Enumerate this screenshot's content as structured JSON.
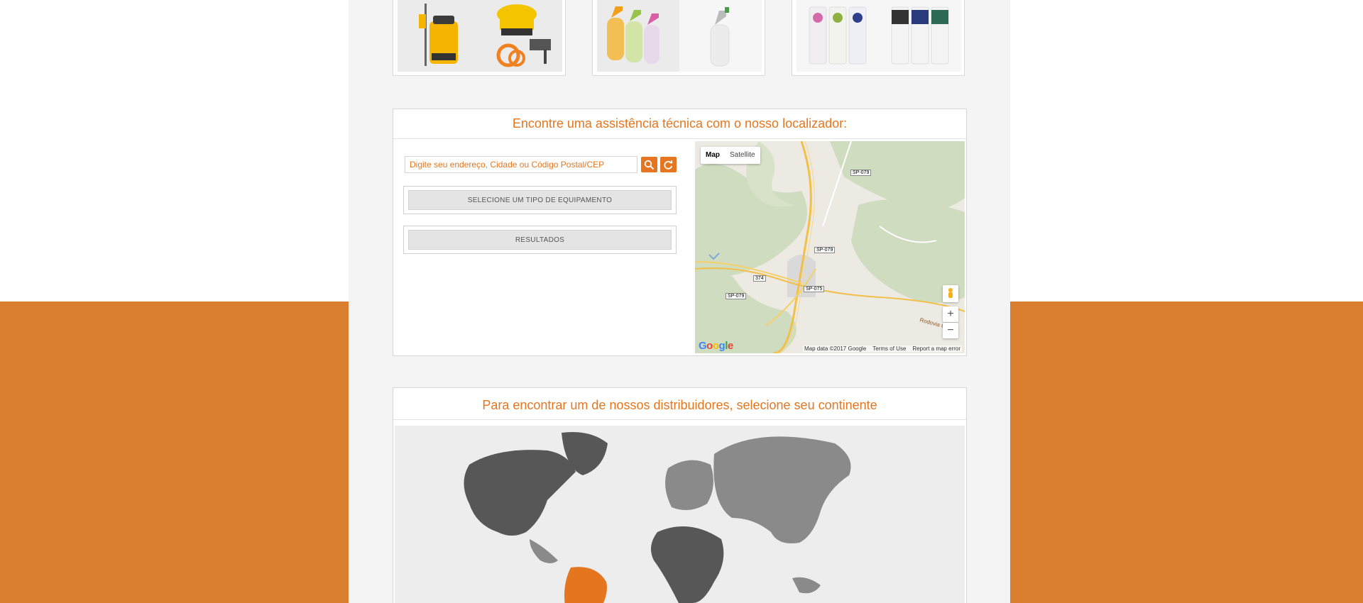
{
  "colors": {
    "brand_orange": "#e5761f",
    "band_orange": "#d97f2f",
    "continent_dark": "#575757",
    "continent_mid": "#8a8a8a",
    "continent_highlight": "#e5761f"
  },
  "locator": {
    "title": "Encontre uma assistência técnica com o nosso localizador:",
    "search_placeholder": "Digite seu endereço, Cidade ou Código Postal/CEP",
    "search_icon": "search-icon",
    "reset_icon": "refresh-icon",
    "equipment_select": "SELECIONE UM TIPO DE EQUIPAMENTO",
    "results": "RESULTADOS"
  },
  "map": {
    "type_map": "Map",
    "type_satellite": "Satellite",
    "zoom_in": "+",
    "zoom_out": "−",
    "pegman_icon": "pegman-icon",
    "logo": "Google",
    "attribution": "Map data ©2017 Google",
    "terms": "Terms of Use",
    "report": "Report a map error",
    "road_labels": [
      "SP-079",
      "SP-079",
      "374",
      "SP-075",
      "SP-079",
      "Rodovia C"
    ]
  },
  "distributors": {
    "title": "Para encontrar um de nossos distribuidores, selecione seu continente",
    "selected_continent": "South America"
  }
}
